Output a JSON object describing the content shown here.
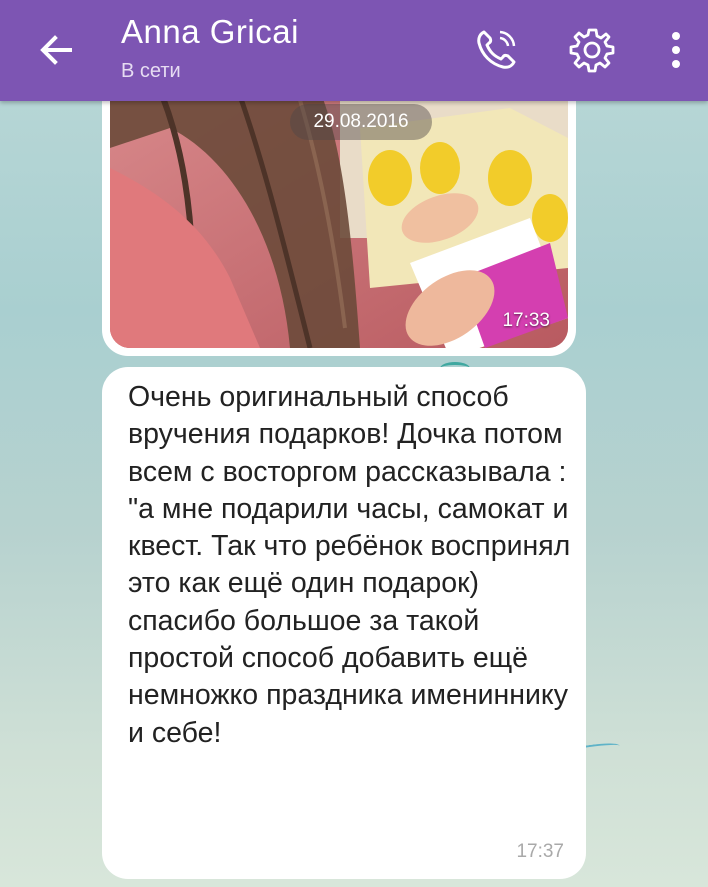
{
  "header": {
    "contact_name": "Anna Gricai",
    "status": "В сети",
    "icons": {
      "back": "arrow-left-icon",
      "call": "phone-icon",
      "settings": "gear-icon",
      "menu": "more-vertical-icon"
    },
    "color": "#7d55b3"
  },
  "chat": {
    "date_separator": "29.08.2016",
    "photo_message": {
      "time": "17:33"
    },
    "text_message": {
      "text": "Очень оригинальный способ вручения подарков! Дочка потом всем с восторгом рассказывала : \"а мне подарили часы, самокат и квест. Так что ребёнок воспринял это как ещё один подарок) спасибо большое за такой простой способ добавить ещё немножко праздника имениннику и себе!",
      "time": "17:37"
    }
  }
}
